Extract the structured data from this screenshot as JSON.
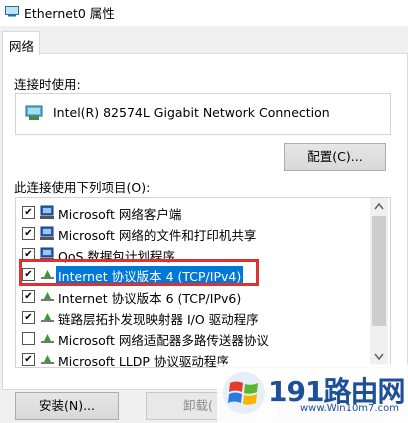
{
  "window": {
    "title": "Ethernet0 属性"
  },
  "tabs": [
    {
      "label": "网络",
      "active": true
    }
  ],
  "connect_using": {
    "label": "连接时使用:",
    "adapter": "Intel(R) 82574L Gigabit Network Connection",
    "configure_button": "配置(C)..."
  },
  "items_section": {
    "label": "此连接使用下列项目(O):",
    "items": [
      {
        "label": "Microsoft 网络客户端",
        "checked": true,
        "icon": "network-client-icon"
      },
      {
        "label": "Microsoft 网络的文件和打印机共享",
        "checked": true,
        "icon": "file-printer-sharing-icon"
      },
      {
        "label": "QoS 数据包计划程序",
        "checked": true,
        "icon": "qos-icon"
      },
      {
        "label": "Internet 协议版本 4 (TCP/IPv4)",
        "checked": true,
        "icon": "protocol-icon",
        "selected": true
      },
      {
        "label": "Internet 协议版本 6 (TCP/IPv6)",
        "checked": true,
        "icon": "protocol-icon"
      },
      {
        "label": "链路层拓扑发现映射器 I/O 驱动程序",
        "checked": true,
        "icon": "protocol-icon"
      },
      {
        "label": "Microsoft 网络适配器多路传送器协议",
        "checked": false,
        "icon": "protocol-icon"
      },
      {
        "label": "Microsoft LLDP 协议驱动程序",
        "checked": true,
        "icon": "protocol-icon"
      }
    ]
  },
  "buttons": {
    "install": "安装(N)...",
    "uninstall": "卸载(",
    "properties": "属性"
  },
  "watermark": {
    "title": "191路由网",
    "subtitle": "www.Win10m7.com"
  },
  "colors": {
    "selection": "#0078d7",
    "highlight_frame": "#e0302f",
    "watermark_text": "#1e4f99"
  }
}
